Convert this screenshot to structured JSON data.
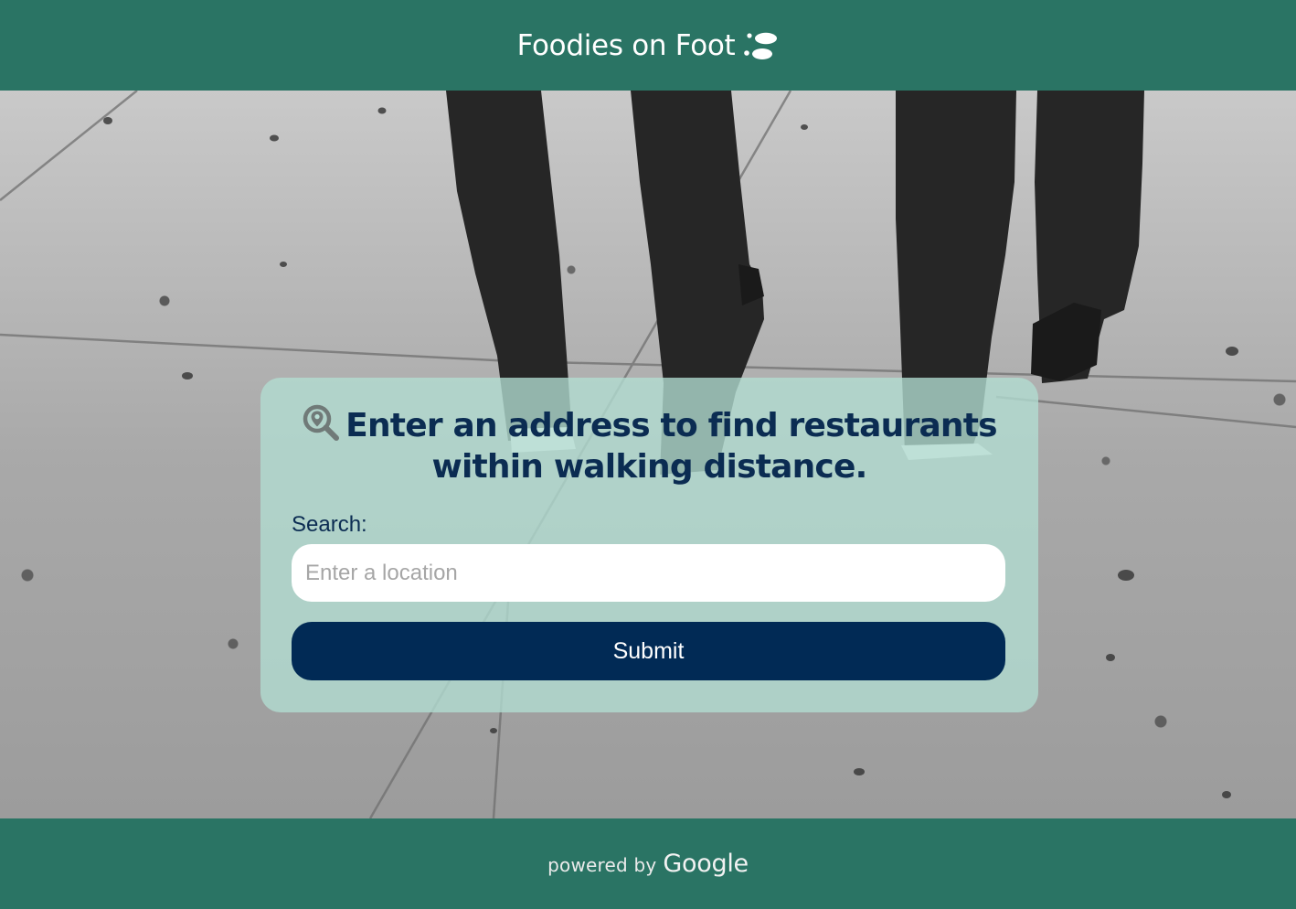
{
  "header": {
    "title": "Foodies on Foot",
    "logo_icon": "footsteps-icon",
    "background_color": "#2a7464"
  },
  "hero": {
    "background_image": "sidewalk-walkers-photo"
  },
  "search_card": {
    "heading_icon": "map-search-icon",
    "heading": "Enter an address to find restaurants within walking distance.",
    "search_label": "Search:",
    "input_placeholder": "Enter a location",
    "input_value": "",
    "submit_label": "Submit",
    "card_color": "#b2ded2",
    "heading_color": "#0b2c52",
    "button_color": "#012a55"
  },
  "footer": {
    "powered_text": "powered by",
    "brand": "Google",
    "background_color": "#2a7464"
  }
}
